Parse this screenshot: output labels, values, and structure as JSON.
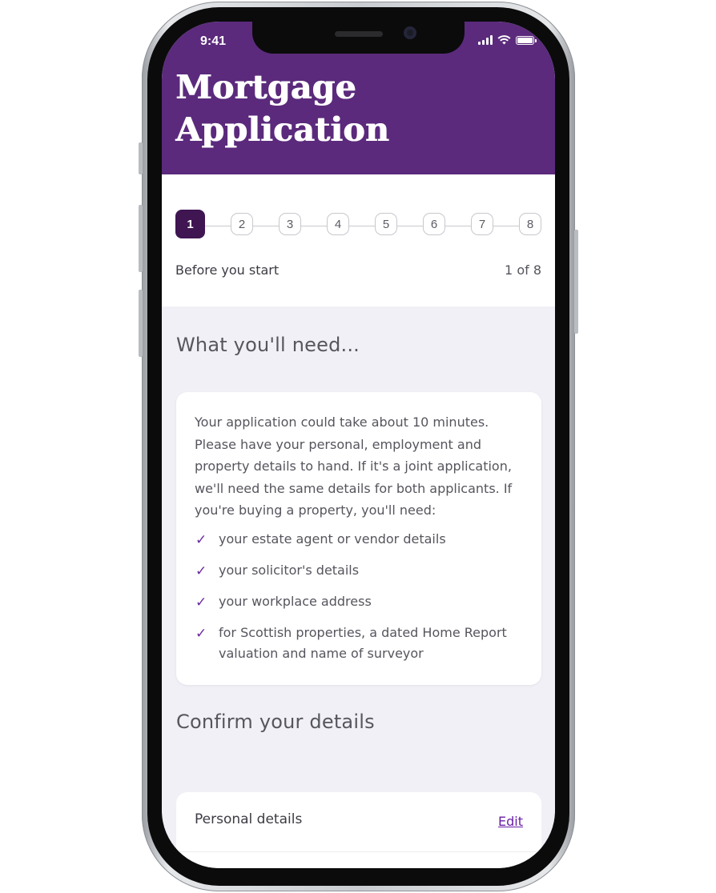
{
  "status_bar": {
    "time": "9:41"
  },
  "header": {
    "title": "Mortgage Application",
    "background_color": "#5b2a7c"
  },
  "stepper": {
    "steps": [
      "1",
      "2",
      "3",
      "4",
      "5",
      "6",
      "7",
      "8"
    ],
    "active_step": 1,
    "current_label": "Before you start",
    "counter": "1 of 8",
    "active_color": "#3f1552"
  },
  "what_you_need": {
    "heading": "What you'll need...",
    "intro": "Your application could take about 10 minutes. Please have your personal, employment and property details to hand. If it's a joint application, we'll need the same details for both applicants. If you're buying a property, you'll need:",
    "checklist": [
      "your estate agent or vendor details",
      "your solicitor's details",
      "your workplace address",
      "for Scottish properties, a dated Home Report valuation and name of surveyor"
    ],
    "check_icon": "checkmark-icon",
    "check_color": "#6a2a9c"
  },
  "confirm_details": {
    "heading": "Confirm your details",
    "rows": [
      {
        "label": "Personal details",
        "action": "Edit"
      }
    ]
  }
}
